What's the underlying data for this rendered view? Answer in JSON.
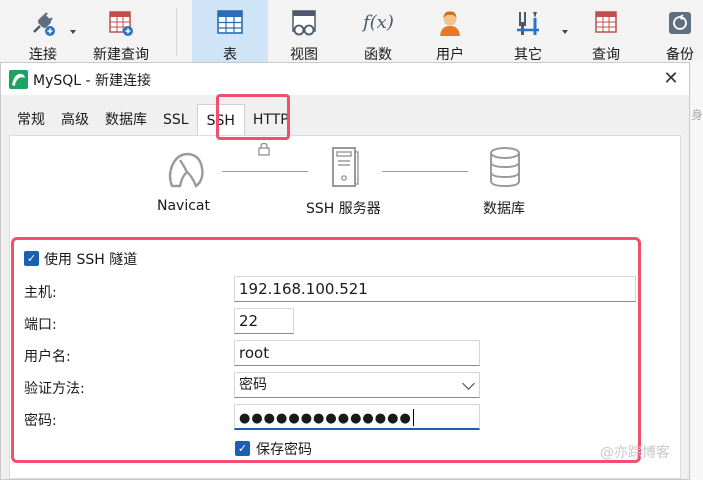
{
  "toolbar": {
    "items": [
      {
        "label": "连接",
        "icon": "plug-icon"
      },
      {
        "label": "新建查询",
        "icon": "new-query-icon"
      },
      {
        "label": "表",
        "icon": "table-icon"
      },
      {
        "label": "视图",
        "icon": "view-icon"
      },
      {
        "label": "函数",
        "icon": "function-icon",
        "glyph": "f(x)"
      },
      {
        "label": "用户",
        "icon": "user-icon"
      },
      {
        "label": "其它",
        "icon": "tools-icon"
      },
      {
        "label": "查询",
        "icon": "query-icon"
      },
      {
        "label": "备份",
        "icon": "backup-icon"
      }
    ],
    "active": "表"
  },
  "dialog": {
    "title": "MySQL - 新建连接",
    "close_glyph": "✕",
    "tabs": [
      "常规",
      "高级",
      "数据库",
      "SSL",
      "SSH",
      "HTTP"
    ],
    "active_tab": "SSH",
    "diagram": {
      "nodes": [
        "Navicat",
        "SSH 服务器",
        "数据库"
      ],
      "link_icon": "lock-icon"
    },
    "ssh": {
      "use_tunnel_label": "使用 SSH 隧道",
      "use_tunnel_checked": true,
      "host_label": "主机:",
      "host_value": "192.168.100.521",
      "port_label": "端口:",
      "port_value": "22",
      "user_label": "用户名:",
      "user_value": "root",
      "auth_label": "验证方法:",
      "auth_value": "密码",
      "password_label": "密码:",
      "password_mask": "●●●●●●●●●●●●●●",
      "save_password_label": "保存密码",
      "save_password_checked": true
    }
  },
  "side_snippet": "身出",
  "watermark": "@亦踪博客",
  "colors": {
    "highlight": "#f0506e",
    "accent": "#1b5fb3",
    "active_toolbar": "#cfe4f7",
    "logo": "#1ba362"
  }
}
